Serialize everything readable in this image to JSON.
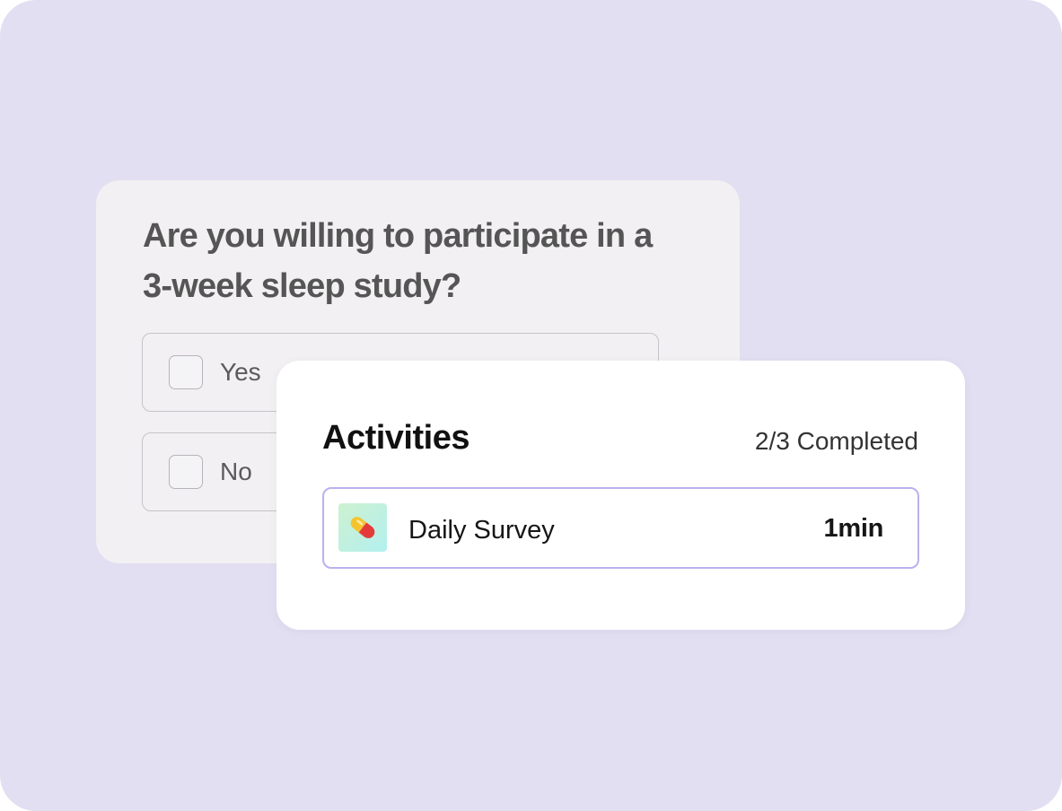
{
  "survey": {
    "question": "Are you willing to participate in a 3-week sleep study?",
    "options": [
      {
        "label": "Yes",
        "checked": false
      },
      {
        "label": "No",
        "checked": false
      }
    ]
  },
  "activities": {
    "title": "Activities",
    "completed_text": "2/3 Completed",
    "items": [
      {
        "icon": "pill-icon",
        "name": "Daily Survey",
        "duration": "1min"
      }
    ]
  },
  "colors": {
    "background": "#e2dff2",
    "question_card": "#f2f0f2",
    "activity_border": "#b9b2ee",
    "pill_red": "#e53a3a",
    "pill_yellow": "#f4c430"
  }
}
